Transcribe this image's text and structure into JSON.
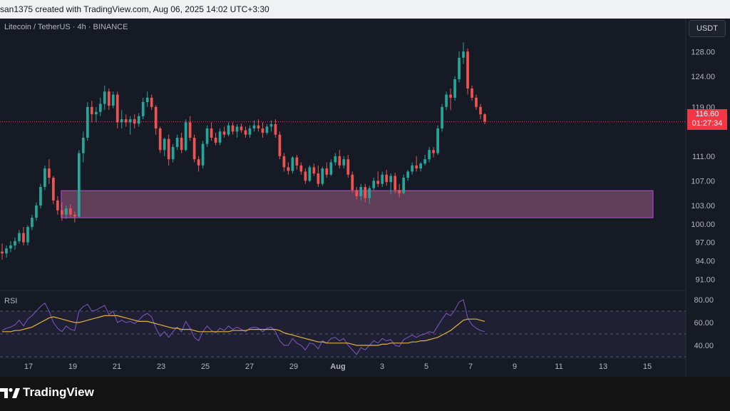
{
  "header": {
    "attribution": "san1375 created with TradingView.com, Aug 06, 2025 14:02 UTC+3:30"
  },
  "symbol_line": "Litecoin / TetherUS · 4h · BINANCE",
  "currency_button": "USDT",
  "last_price": {
    "price": "116.60",
    "countdown": "01:27:34"
  },
  "rsi_label": "RSI",
  "brand": {
    "name": "TradingView",
    "logo_icon": "tradingview-logo-icon"
  },
  "colors": {
    "up": "#26a69a",
    "down": "#ef5350",
    "zone_fill": "#7a4a6a",
    "zone_border": "#b040d0",
    "rsi_line": "#7e57c2",
    "rsi_ma": "#e0b23a"
  },
  "chart_data": [
    {
      "type": "candlestick",
      "title": "",
      "x_ticks": [
        "17",
        "19",
        "21",
        "23",
        "25",
        "27",
        "29",
        "Aug",
        "3",
        "5",
        "7",
        "9",
        "11",
        "13",
        "15"
      ],
      "y_ticks": [
        "128.00",
        "124.00",
        "119.00",
        "111.00",
        "107.00",
        "103.00",
        "100.00",
        "97.00",
        "94.00",
        "91.00"
      ],
      "y_tick_values": [
        128,
        124,
        119,
        111,
        107,
        103,
        100,
        97,
        94,
        91
      ],
      "ylim": [
        90,
        130
      ],
      "ohlc": [
        [
          95.5,
          96.8,
          94.2,
          95.2
        ],
        [
          95.2,
          96.5,
          94.5,
          96.0
        ],
        [
          96.0,
          97.2,
          95.4,
          96.5
        ],
        [
          96.5,
          97.8,
          95.8,
          97.2
        ],
        [
          97.2,
          99.0,
          96.8,
          98.5
        ],
        [
          98.5,
          99.5,
          96.5,
          97.0
        ],
        [
          97.0,
          99.8,
          96.5,
          99.5
        ],
        [
          99.5,
          101.5,
          99.0,
          101.0
        ],
        [
          101.0,
          103.5,
          100.5,
          103.0
        ],
        [
          103.0,
          106.5,
          102.5,
          106.0
        ],
        [
          106.0,
          109.5,
          105.5,
          109.0
        ],
        [
          109.0,
          110.5,
          106.5,
          107.5
        ],
        [
          107.5,
          107.8,
          103.2,
          103.8
        ],
        [
          103.8,
          104.5,
          101.5,
          102.2
        ],
        [
          102.2,
          103.5,
          100.5,
          101.5
        ],
        [
          101.5,
          103.0,
          100.8,
          102.5
        ],
        [
          102.5,
          103.2,
          101.0,
          101.5
        ],
        [
          101.5,
          102.0,
          100.2,
          101.2
        ],
        [
          101.2,
          112.0,
          101.0,
          111.5
        ],
        [
          111.5,
          115.0,
          110.0,
          114.0
        ],
        [
          114.0,
          119.8,
          113.5,
          119.0
        ],
        [
          119.0,
          120.0,
          116.5,
          117.8
        ],
        [
          117.8,
          119.0,
          116.5,
          118.2
        ],
        [
          118.2,
          120.5,
          117.5,
          119.5
        ],
        [
          119.5,
          122.5,
          118.5,
          121.5
        ],
        [
          121.5,
          122.0,
          118.5,
          119.2
        ],
        [
          119.2,
          121.5,
          118.8,
          121.0
        ],
        [
          121.0,
          121.5,
          115.5,
          116.5
        ],
        [
          116.5,
          118.5,
          115.5,
          117.0
        ],
        [
          117.0,
          117.8,
          115.8,
          116.5
        ],
        [
          116.5,
          117.5,
          114.5,
          117.0
        ],
        [
          117.0,
          117.8,
          115.5,
          116.3
        ],
        [
          116.3,
          118.0,
          115.8,
          117.5
        ],
        [
          117.5,
          120.5,
          117.0,
          119.8
        ],
        [
          119.8,
          121.5,
          119.0,
          120.5
        ],
        [
          120.5,
          121.0,
          118.5,
          119.0
        ],
        [
          119.0,
          119.3,
          114.5,
          115.5
        ],
        [
          115.5,
          115.8,
          111.5,
          112.0
        ],
        [
          112.0,
          114.0,
          111.0,
          113.8
        ],
        [
          113.8,
          114.5,
          109.5,
          110.5
        ],
        [
          110.5,
          113.0,
          110.0,
          112.5
        ],
        [
          112.5,
          114.5,
          112.0,
          114.0
        ],
        [
          114.0,
          114.8,
          111.5,
          112.0
        ],
        [
          112.0,
          117.0,
          111.8,
          116.5
        ],
        [
          116.5,
          117.5,
          113.5,
          114.0
        ],
        [
          114.0,
          114.5,
          110.0,
          110.5
        ],
        [
          110.5,
          111.0,
          108.5,
          109.5
        ],
        [
          109.5,
          113.5,
          109.0,
          113.0
        ],
        [
          113.0,
          116.0,
          112.5,
          115.5
        ],
        [
          115.5,
          116.5,
          113.5,
          114.0
        ],
        [
          114.0,
          114.8,
          112.8,
          113.2
        ],
        [
          113.2,
          115.5,
          112.8,
          115.0
        ],
        [
          115.0,
          115.8,
          114.0,
          114.5
        ],
        [
          114.5,
          116.5,
          114.2,
          116.0
        ],
        [
          116.0,
          116.5,
          114.5,
          115.0
        ],
        [
          115.0,
          116.2,
          114.0,
          115.8
        ],
        [
          115.8,
          116.3,
          114.8,
          115.2
        ],
        [
          115.2,
          115.8,
          114.0,
          114.5
        ],
        [
          114.5,
          116.0,
          114.0,
          115.5
        ],
        [
          115.5,
          116.8,
          115.0,
          116.0
        ],
        [
          116.0,
          117.0,
          115.0,
          115.5
        ],
        [
          115.5,
          116.5,
          114.0,
          114.8
        ],
        [
          114.8,
          116.2,
          114.5,
          115.8
        ],
        [
          115.8,
          116.8,
          115.0,
          116.2
        ],
        [
          116.2,
          117.0,
          114.0,
          114.5
        ],
        [
          114.5,
          115.0,
          110.5,
          111.0
        ],
        [
          111.0,
          111.5,
          108.5,
          109.2
        ],
        [
          109.2,
          110.0,
          108.0,
          108.6
        ],
        [
          108.6,
          111.0,
          108.2,
          110.8
        ],
        [
          110.8,
          111.2,
          108.8,
          109.5
        ],
        [
          109.5,
          110.0,
          108.0,
          108.5
        ],
        [
          108.5,
          109.0,
          106.5,
          107.0
        ],
        [
          107.0,
          109.5,
          106.8,
          109.2
        ],
        [
          109.2,
          109.8,
          107.8,
          108.2
        ],
        [
          108.2,
          109.5,
          106.0,
          106.5
        ],
        [
          106.5,
          109.3,
          106.2,
          109.0
        ],
        [
          109.0,
          110.0,
          107.5,
          108.0
        ],
        [
          108.0,
          110.5,
          107.8,
          110.0
        ],
        [
          110.0,
          111.5,
          109.5,
          111.0
        ],
        [
          111.0,
          112.0,
          109.0,
          109.5
        ],
        [
          109.5,
          111.0,
          109.0,
          110.5
        ],
        [
          110.5,
          111.2,
          107.5,
          108.0
        ],
        [
          108.0,
          108.5,
          105.0,
          105.5
        ],
        [
          105.5,
          106.0,
          104.0,
          104.5
        ],
        [
          104.5,
          106.5,
          103.8,
          106.0
        ],
        [
          106.0,
          106.5,
          103.5,
          104.2
        ],
        [
          104.2,
          106.2,
          103.2,
          105.8
        ],
        [
          105.8,
          107.5,
          105.5,
          107.0
        ],
        [
          107.0,
          108.5,
          106.0,
          106.5
        ],
        [
          106.5,
          108.5,
          106.0,
          108.0
        ],
        [
          108.0,
          108.8,
          106.2,
          106.8
        ],
        [
          106.8,
          108.2,
          104.8,
          107.8
        ],
        [
          107.8,
          108.3,
          105.0,
          105.5
        ],
        [
          105.5,
          106.5,
          104.3,
          105.0
        ],
        [
          105.0,
          108.0,
          104.8,
          107.5
        ],
        [
          107.5,
          108.8,
          107.0,
          108.5
        ],
        [
          108.5,
          110.0,
          108.0,
          109.5
        ],
        [
          109.5,
          111.0,
          108.5,
          109.0
        ],
        [
          109.0,
          110.0,
          108.5,
          109.8
        ],
        [
          109.8,
          111.2,
          109.5,
          110.5
        ],
        [
          110.5,
          112.5,
          110.0,
          112.0
        ],
        [
          112.0,
          112.5,
          110.8,
          111.5
        ],
        [
          111.5,
          116.0,
          111.2,
          115.5
        ],
        [
          115.5,
          119.5,
          115.0,
          119.0
        ],
        [
          119.0,
          121.5,
          118.5,
          121.0
        ],
        [
          121.0,
          122.0,
          118.5,
          120.5
        ],
        [
          120.5,
          124.0,
          120.0,
          123.5
        ],
        [
          123.5,
          128.0,
          123.0,
          127.0
        ],
        [
          127.0,
          129.5,
          126.0,
          128.0
        ],
        [
          128.0,
          128.5,
          121.0,
          122.0
        ],
        [
          122.0,
          122.5,
          120.0,
          120.5
        ],
        [
          120.5,
          121.0,
          118.5,
          119.0
        ],
        [
          119.0,
          119.5,
          117.0,
          117.8
        ],
        [
          117.8,
          118.0,
          116.2,
          116.6
        ]
      ],
      "demand_zone": {
        "top": 105.4,
        "bottom": 101.0
      },
      "last_price_line": 116.6
    },
    {
      "type": "line",
      "title": "RSI",
      "y_ticks": [
        "80.00",
        "60.00",
        "40.00"
      ],
      "y_tick_values": [
        80,
        60,
        40
      ],
      "ylim": [
        30,
        85
      ],
      "levels": [
        70,
        50,
        30
      ],
      "rsi": [
        53,
        55,
        56,
        58,
        62,
        57,
        63,
        66,
        70,
        74,
        77,
        70,
        60,
        55,
        52,
        57,
        54,
        53,
        70,
        74,
        76,
        70,
        71,
        73,
        75,
        67,
        70,
        60,
        62,
        60,
        61,
        59,
        62,
        66,
        68,
        65,
        55,
        48,
        52,
        47,
        52,
        56,
        52,
        61,
        55,
        47,
        44,
        52,
        57,
        53,
        51,
        55,
        53,
        57,
        54,
        56,
        54,
        52,
        55,
        56,
        55,
        52,
        55,
        56,
        52,
        44,
        40,
        40,
        46,
        42,
        40,
        36,
        42,
        41,
        37,
        44,
        42,
        46,
        47,
        44,
        46,
        40,
        36,
        32,
        38,
        36,
        40,
        44,
        42,
        46,
        44,
        45,
        40,
        39,
        45,
        47,
        49,
        47,
        49,
        50,
        52,
        51,
        57,
        63,
        68,
        66,
        71,
        78,
        80,
        64,
        58,
        55,
        53,
        52
      ],
      "rsi_ma": [
        52,
        52,
        52,
        53,
        53,
        54,
        55,
        56,
        58,
        60,
        62,
        64,
        65,
        64,
        63,
        62,
        61,
        60,
        60,
        61,
        62,
        63,
        64,
        65,
        66,
        66,
        66,
        66,
        65,
        64,
        63,
        62,
        61,
        61,
        61,
        60,
        59,
        58,
        57,
        56,
        55,
        55,
        54,
        54,
        54,
        53,
        52,
        52,
        52,
        52,
        52,
        52,
        52,
        52,
        53,
        53,
        53,
        53,
        54,
        54,
        54,
        54,
        54,
        54,
        54,
        53,
        51,
        50,
        49,
        48,
        47,
        46,
        45,
        44,
        43,
        43,
        42,
        42,
        42,
        42,
        42,
        42,
        41,
        40,
        40,
        40,
        40,
        40,
        40,
        41,
        41,
        42,
        42,
        42,
        42,
        42,
        43,
        43,
        44,
        44,
        45,
        46,
        47,
        49,
        51,
        53,
        56,
        59,
        62,
        63,
        63,
        63,
        62,
        61
      ]
    }
  ]
}
